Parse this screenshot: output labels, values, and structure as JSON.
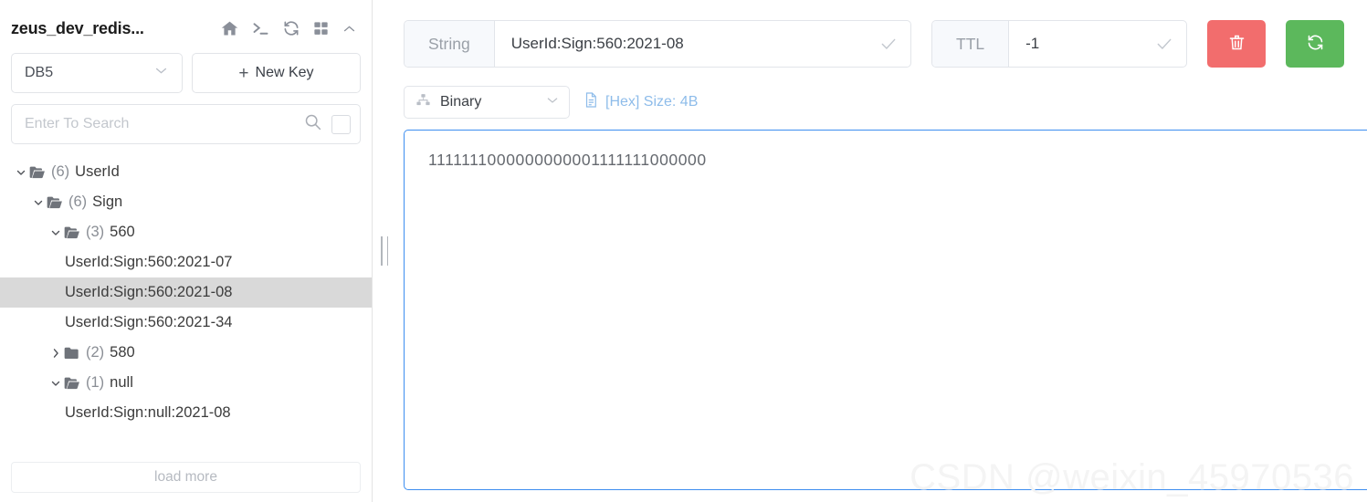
{
  "sidebar": {
    "title": "zeus_dev_redis...",
    "header_icons": [
      {
        "name": "home-icon"
      },
      {
        "name": "terminal-icon"
      },
      {
        "name": "refresh-icon"
      },
      {
        "name": "grid-icon"
      },
      {
        "name": "chevron-up-icon"
      }
    ],
    "db_select": {
      "value": "DB5"
    },
    "new_key_button": {
      "label": "New Key",
      "plus": "+"
    },
    "search": {
      "value": "",
      "placeholder": "Enter To Search"
    },
    "tree": [
      {
        "depth": 0,
        "type": "folder",
        "state": "open",
        "count": "(6)",
        "label": "UserId",
        "selected": false
      },
      {
        "depth": 1,
        "type": "folder",
        "state": "open",
        "count": "(6)",
        "label": "Sign",
        "selected": false
      },
      {
        "depth": 2,
        "type": "folder",
        "state": "open",
        "count": "(3)",
        "label": "560",
        "selected": false
      },
      {
        "depth": 3,
        "type": "key",
        "state": "none",
        "count": "",
        "label": "UserId:Sign:560:2021-07",
        "selected": false
      },
      {
        "depth": 3,
        "type": "key",
        "state": "none",
        "count": "",
        "label": "UserId:Sign:560:2021-08",
        "selected": true
      },
      {
        "depth": 3,
        "type": "key",
        "state": "none",
        "count": "",
        "label": "UserId:Sign:560:2021-34",
        "selected": false
      },
      {
        "depth": 2,
        "type": "folder",
        "state": "closed",
        "count": "(2)",
        "label": "580",
        "selected": false
      },
      {
        "depth": 2,
        "type": "folder",
        "state": "open",
        "count": "(1)",
        "label": "null",
        "selected": false
      },
      {
        "depth": 3,
        "type": "key",
        "state": "none",
        "count": "",
        "label": "UserId:Sign:null:2021-08",
        "selected": false
      }
    ],
    "load_more": {
      "label": "load more"
    }
  },
  "main": {
    "key_type_label": "String",
    "key_name": "UserId:Sign:560:2021-08",
    "ttl_label": "TTL",
    "ttl_value": "-1",
    "delete_button": {
      "name": "trash-icon"
    },
    "refresh_button": {
      "name": "refresh-icon"
    },
    "format_select": {
      "value": "Binary"
    },
    "hex_info": "[Hex] Size: 4B",
    "content": "1111111000000000001111111000000"
  },
  "watermark": "CSDN @weixin_45970536",
  "colors": {
    "delete": "#f26d6d",
    "refresh": "#5cb85c",
    "focus_border": "#3d8ef0",
    "link": "#8ebcea",
    "selected_row": "#d9d9d9"
  }
}
